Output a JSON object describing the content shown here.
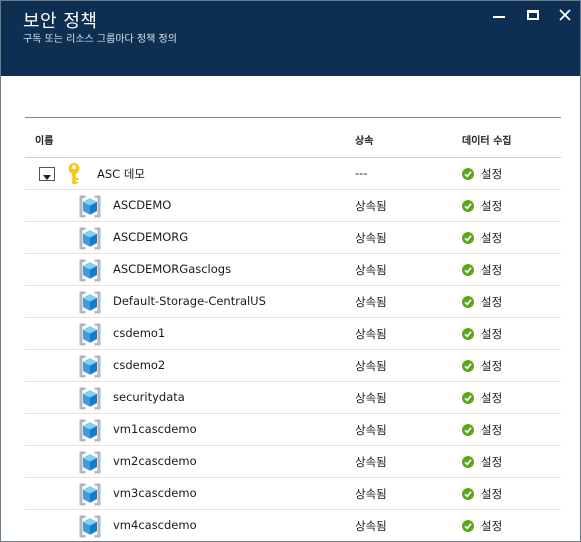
{
  "header": {
    "title": "보안 정책",
    "subtitle": "구독 또는 리소스 그룹마다 정책 정의"
  },
  "table": {
    "columns": {
      "name": "이름",
      "inheritance": "상속",
      "data_collection": "데이터 수집"
    },
    "root": {
      "name": "ASC 데모",
      "inheritance": "---",
      "data_collection": "설정"
    },
    "rows": [
      {
        "name": "ASCDEMO",
        "inheritance": "상속됨",
        "data_collection": "설정"
      },
      {
        "name": "ASCDEMORG",
        "inheritance": "상속됨",
        "data_collection": "설정"
      },
      {
        "name": "ASCDEMORGasclogs",
        "inheritance": "상속됨",
        "data_collection": "설정"
      },
      {
        "name": "Default-Storage-CentralUS",
        "inheritance": "상속됨",
        "data_collection": "설정"
      },
      {
        "name": "csdemo1",
        "inheritance": "상속됨",
        "data_collection": "설정"
      },
      {
        "name": "csdemo2",
        "inheritance": "상속됨",
        "data_collection": "설정"
      },
      {
        "name": "securitydata",
        "inheritance": "상속됨",
        "data_collection": "설정"
      },
      {
        "name": "vm1cascdemo",
        "inheritance": "상속됨",
        "data_collection": "설정"
      },
      {
        "name": "vm2cascdemo",
        "inheritance": "상속됨",
        "data_collection": "설정"
      },
      {
        "name": "vm3cascdemo",
        "inheritance": "상속됨",
        "data_collection": "설정"
      },
      {
        "name": "vm4cascdemo",
        "inheritance": "상속됨",
        "data_collection": "설정"
      }
    ]
  },
  "icons": {
    "minimize": "minimize-icon",
    "maximize": "maximize-icon",
    "close": "close-icon",
    "expand": "chevron-down-icon",
    "subscription": "key-icon",
    "resource_group": "cube-icon",
    "status": "check-circle-icon"
  },
  "colors": {
    "header_bg": "#0c2f52",
    "status_ok": "#5ba71b",
    "cube_blue": "#3a9fdc"
  }
}
